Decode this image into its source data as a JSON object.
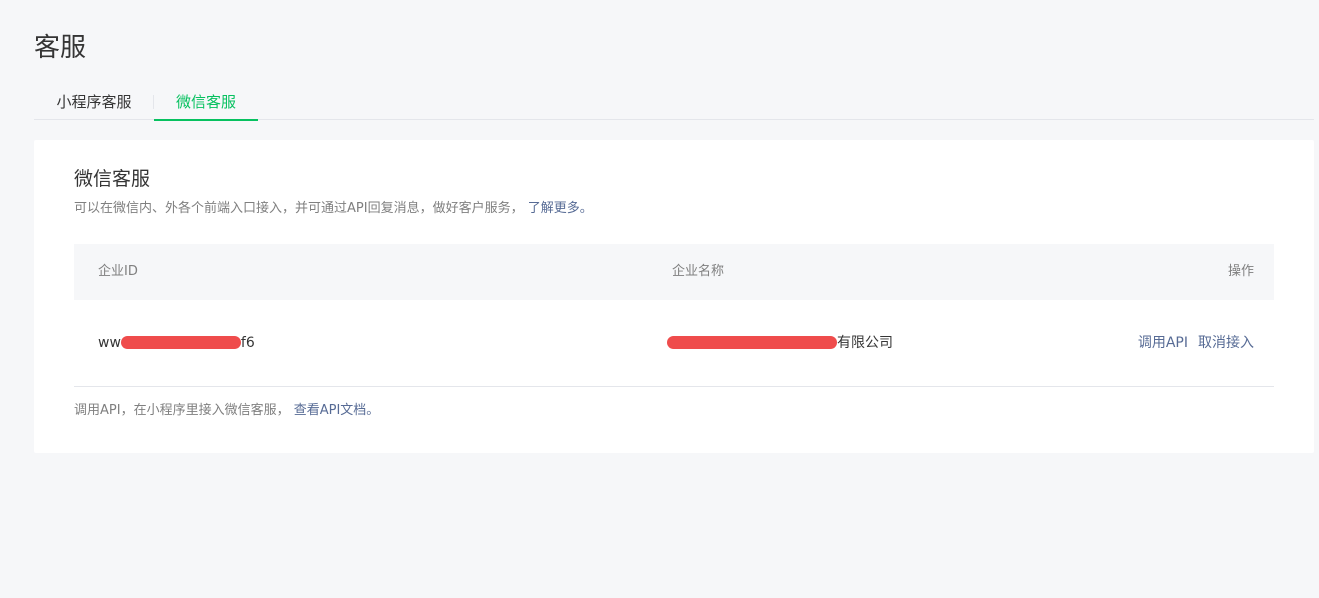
{
  "header": {
    "title": "客服"
  },
  "tabs": [
    {
      "label": "小程序客服",
      "active": false
    },
    {
      "label": "微信客服",
      "active": true
    }
  ],
  "card": {
    "title": "微信客服",
    "description": "可以在微信内、外各个前端入口接入，并可通过API回复消息，做好客户服务，",
    "learn_more": "了解更多。",
    "footer_text": "调用API，在小程序里接入微信客服，",
    "footer_link": "查看API文档。"
  },
  "table": {
    "columns": [
      "企业ID",
      "企业名称",
      "操作"
    ],
    "rows": [
      {
        "corp_id_prefix": "ww",
        "corp_id_suffix": "f6",
        "corp_name_suffix": "有限公司",
        "actions": [
          "调用API",
          "取消接入"
        ]
      }
    ]
  },
  "colors": {
    "accent": "#07c160",
    "link": "#576b95",
    "redaction": "#ef4c4c",
    "background": "#f6f7f9"
  }
}
